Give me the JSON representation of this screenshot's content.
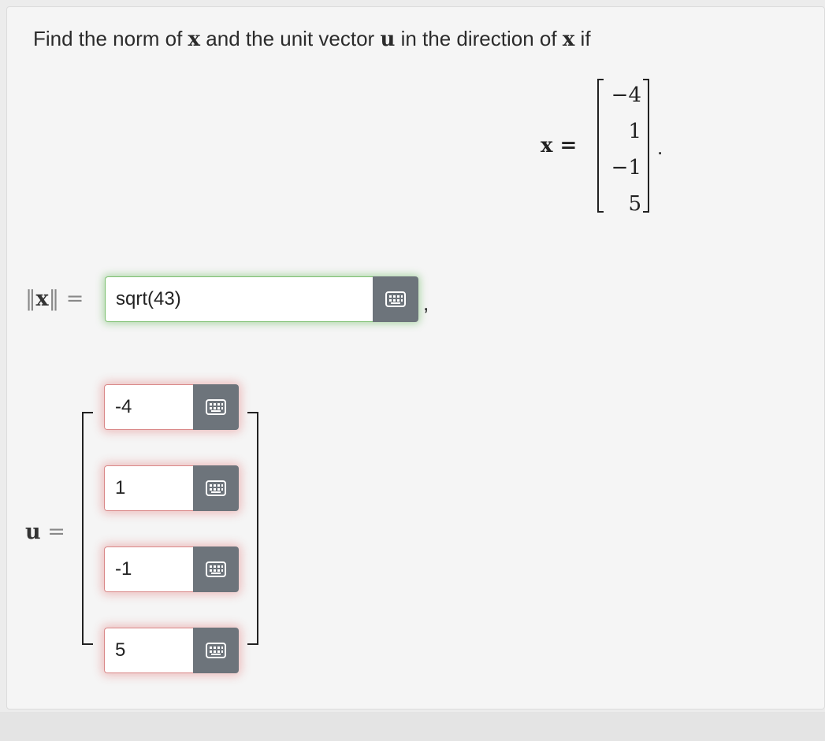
{
  "prompt": {
    "prefix": "Find the norm of ",
    "x": "x",
    "middle": " and the unit vector ",
    "u": "u",
    "suffix_pre": " in the direction of ",
    "x2": "x",
    "suffix": " if"
  },
  "given": {
    "lhs": "x =",
    "entries": [
      "−4",
      "1",
      "−1",
      "5"
    ],
    "trailing": "."
  },
  "norm": {
    "lhs_left": "‖",
    "lhs_x": "x",
    "lhs_right": "‖ =",
    "value": "sqrt(43)",
    "trailing": ","
  },
  "unit_vector": {
    "lhs": "u",
    "eq": " =",
    "entries": [
      {
        "value": "-4"
      },
      {
        "value": "1"
      },
      {
        "value": "-1"
      },
      {
        "value": "5"
      }
    ]
  },
  "colors": {
    "correct_glow": "#57b14c",
    "incorrect_glow": "#dc3c3c",
    "button_bg": "#6d747b"
  },
  "icons": {
    "keyboard_button": "keyboard-icon"
  }
}
